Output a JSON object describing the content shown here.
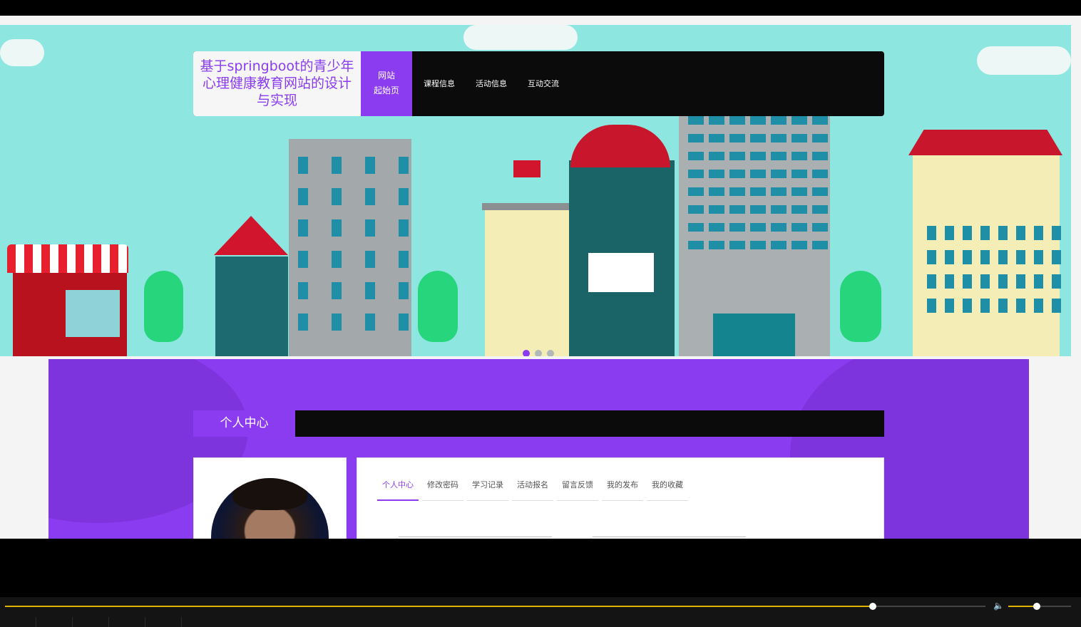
{
  "site": {
    "title": "基于springboot的青少年心理健康教育网站的设计与实现",
    "home_line1": "网站",
    "home_line2": "起始页",
    "nav_items": [
      "课程信息",
      "活动信息",
      "互动交流"
    ]
  },
  "carousel": {
    "slide_count": 3,
    "active_index": 0
  },
  "section": {
    "title": "个人中心"
  },
  "tabs": [
    "个人中心",
    "修改密码",
    "学习记录",
    "活动报名",
    "留言反馈",
    "我的发布",
    "我的收藏"
  ],
  "active_tab": 0,
  "colors": {
    "accent": "#8b3cf0",
    "nav_bg": "#0b0b0b",
    "sky": "#8ee6e0",
    "player_progress": "#e2b400"
  },
  "player": {
    "progress": 0.885,
    "volume": 0.45
  }
}
